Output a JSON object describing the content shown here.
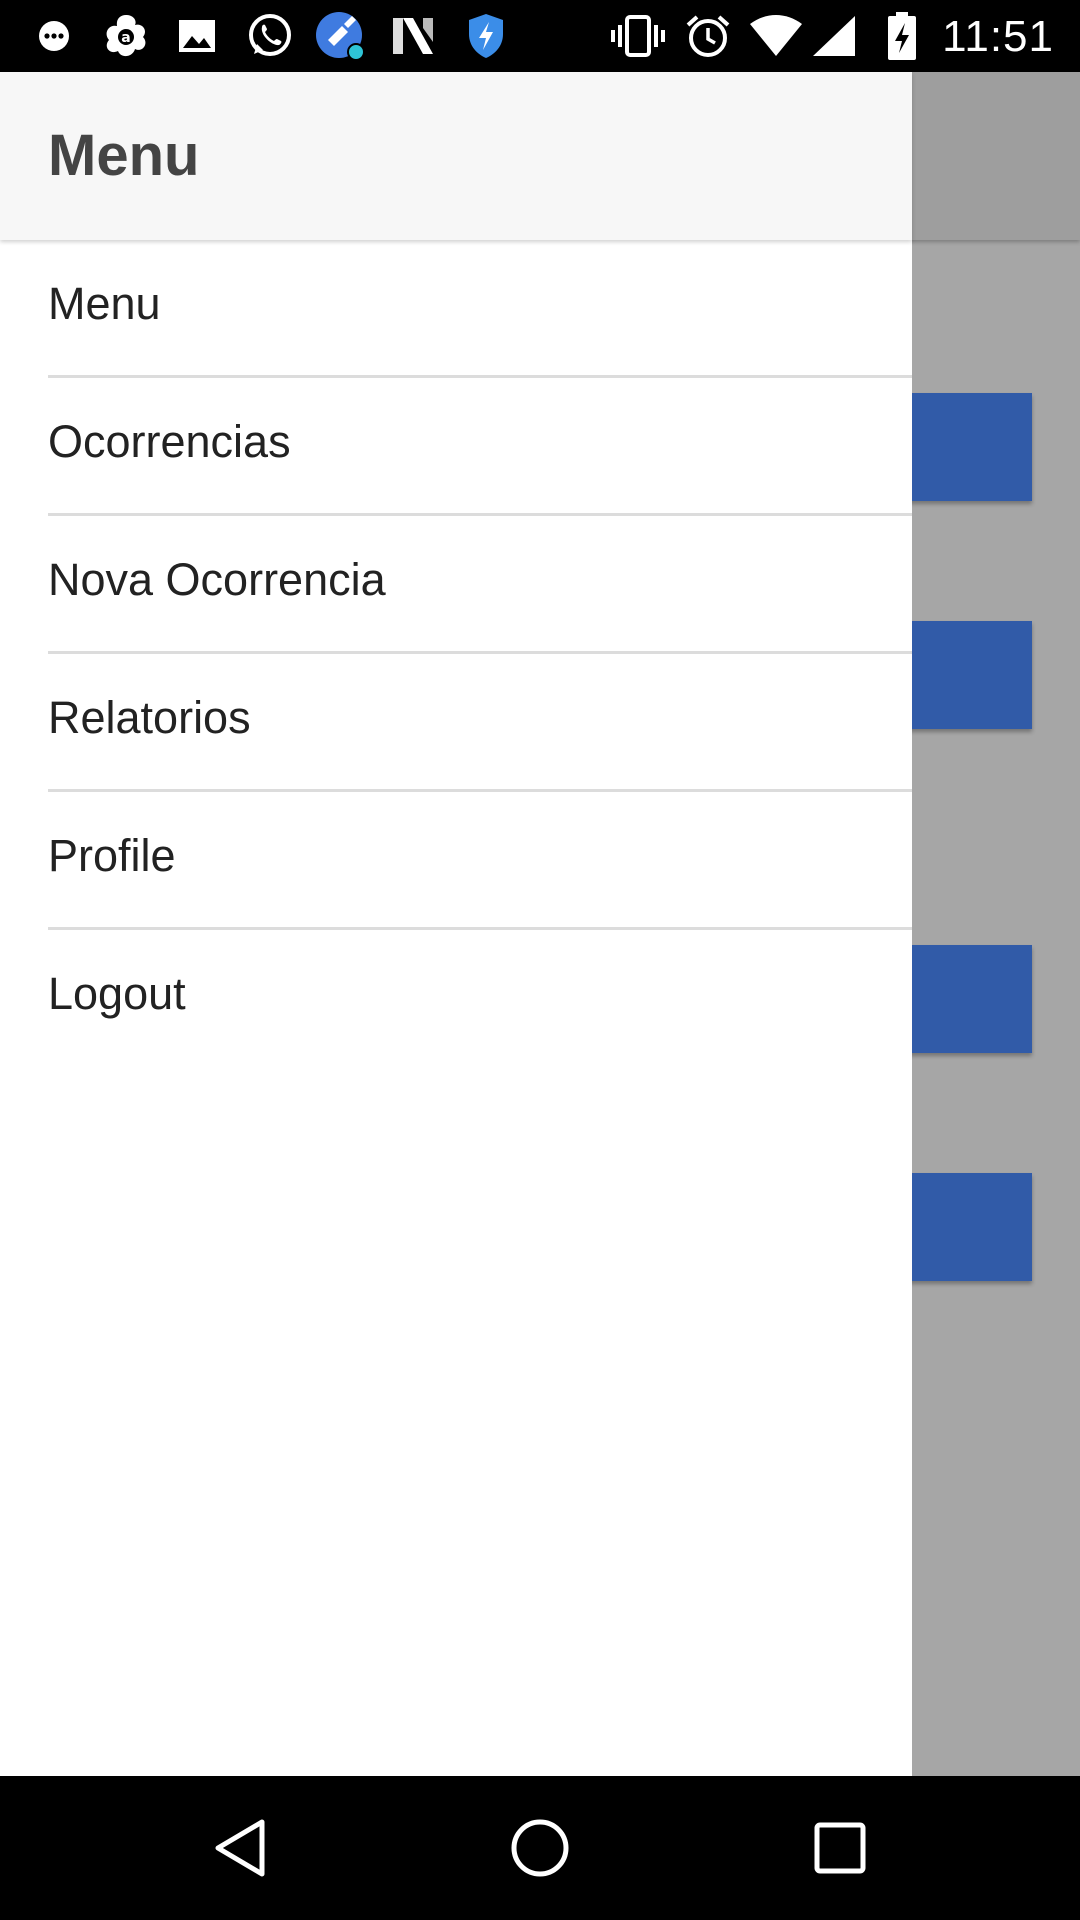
{
  "status_bar": {
    "time": "11:51",
    "notification_icons": [
      "messaging-icon",
      "avast-icon",
      "gallery-icon",
      "whatsapp-icon",
      "cleaner-icon",
      "n-app-icon",
      "shield-icon"
    ],
    "system_icons": [
      "vibrate-icon",
      "alarm-icon",
      "wifi-icon",
      "signal-icon",
      "battery-charging-icon"
    ]
  },
  "drawer": {
    "title": "Menu",
    "items": [
      {
        "label": "Menu"
      },
      {
        "label": "Ocorrencias"
      },
      {
        "label": "Nova Ocorrencia"
      },
      {
        "label": "Relatorios"
      },
      {
        "label": "Profile"
      },
      {
        "label": "Logout"
      }
    ]
  },
  "nav_bar": {
    "buttons": [
      "back-icon",
      "home-icon",
      "recents-icon"
    ]
  },
  "colors": {
    "accent_button": "#315ba8",
    "scrim": "#a6a6a6",
    "drawer_header": "#f7f7f7",
    "status_bar": "#000000"
  }
}
